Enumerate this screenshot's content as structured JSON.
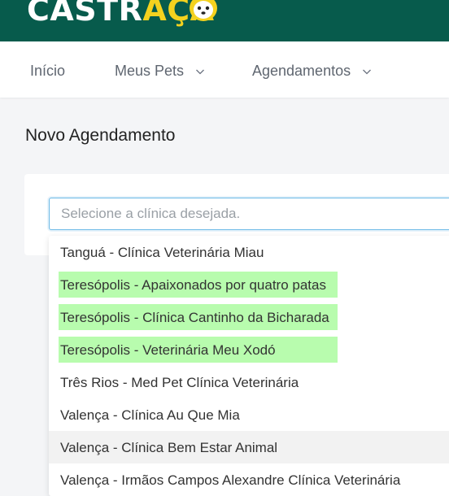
{
  "brand": {
    "logo_part1": "CASTR",
    "logo_part2": "AÇA",
    "mascot_icon": "dog-cat-mascot-icon"
  },
  "nav": {
    "items": [
      {
        "label": "Início",
        "has_dropdown": false
      },
      {
        "label": "Meus Pets",
        "has_dropdown": true
      },
      {
        "label": "Agendamentos",
        "has_dropdown": true
      }
    ]
  },
  "page": {
    "title": "Novo Agendamento"
  },
  "clinic_select": {
    "placeholder": "Selecione a clínica desejada.",
    "value": "",
    "options": [
      {
        "label": "Tanguá - Clínica Veterinária Miau",
        "highlighted": false,
        "hovered": false
      },
      {
        "label": "Teresópolis - Apaixonados por quatro patas",
        "highlighted": true,
        "hovered": false
      },
      {
        "label": "Teresópolis - Clínica Cantinho da Bicharada",
        "highlighted": true,
        "hovered": false
      },
      {
        "label": "Teresópolis - Veterinária Meu Xodó",
        "highlighted": true,
        "hovered": false
      },
      {
        "label": "Três Rios - Med Pet Clínica Veterinária",
        "highlighted": false,
        "hovered": false
      },
      {
        "label": "Valença - Clínica Au Que Mia",
        "highlighted": false,
        "hovered": false
      },
      {
        "label": "Valença - Clínica Bem Estar Animal",
        "highlighted": false,
        "hovered": true
      },
      {
        "label": "Valença - Irmãos Campos Alexandre Clínica Veterinária",
        "highlighted": false,
        "hovered": false
      }
    ]
  },
  "colors": {
    "header_bg": "#075b4c",
    "logo_accent": "#f4d21e",
    "highlight": "#b8fcae",
    "input_focus_border": "#69b8e6"
  }
}
